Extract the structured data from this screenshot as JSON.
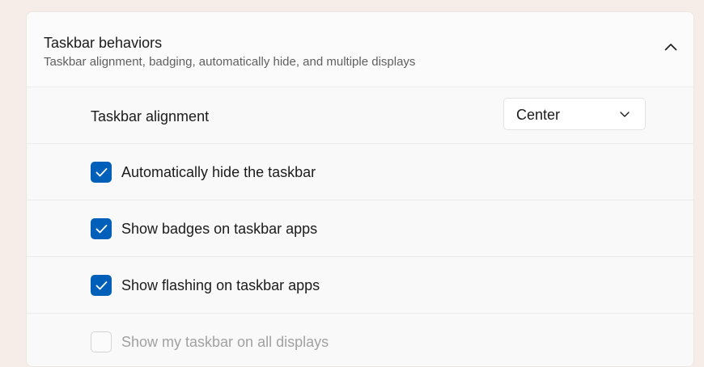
{
  "section": {
    "title": "Taskbar behaviors",
    "subtitle": "Taskbar alignment, badging, automatically hide, and multiple displays",
    "collapse_icon": "chevron-up-icon"
  },
  "alignment": {
    "label": "Taskbar alignment",
    "value": "Center",
    "chevron_icon": "chevron-down-icon"
  },
  "options": [
    {
      "label": "Automatically hide the taskbar",
      "checked": true,
      "enabled": true
    },
    {
      "label": "Show badges on taskbar apps",
      "checked": true,
      "enabled": true
    },
    {
      "label": "Show flashing on taskbar apps",
      "checked": true,
      "enabled": true
    },
    {
      "label": "Show my taskbar on all displays",
      "checked": false,
      "enabled": false
    }
  ],
  "colors": {
    "accent": "#005fb8",
    "background": "#f7ede8",
    "panel": "#fbfbfb",
    "disabled_text": "#a1a1a1"
  }
}
